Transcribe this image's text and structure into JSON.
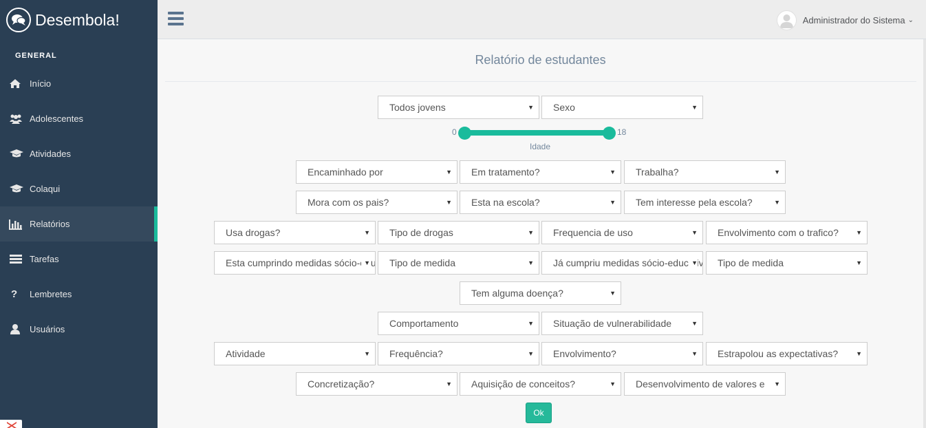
{
  "brand": {
    "title": "Desembola!"
  },
  "sidebar": {
    "section_label": "GENERAL",
    "items": [
      {
        "label": "Início",
        "icon": "home-icon"
      },
      {
        "label": "Adolescentes",
        "icon": "users-icon"
      },
      {
        "label": "Atividades",
        "icon": "graduation-cap-icon"
      },
      {
        "label": "Colaqui",
        "icon": "graduation-cap-icon"
      },
      {
        "label": "Relatórios",
        "icon": "bar-chart-icon",
        "active": true
      },
      {
        "label": "Tarefas",
        "icon": "list-icon"
      },
      {
        "label": "Lembretes",
        "icon": "question-icon"
      },
      {
        "label": "Usuários",
        "icon": "user-icon"
      }
    ]
  },
  "topnav": {
    "user_name": "Administrador do Sistema"
  },
  "page": {
    "title": "Relatório de estudantes"
  },
  "filters": {
    "todos_jovens": "Todos jovens",
    "sexo": "Sexo",
    "encaminhado_por": "Encaminhado por",
    "em_tratamento": "Em tratamento?",
    "trabalha": "Trabalha?",
    "mora_com_pais": "Mora com os pais?",
    "esta_na_escola": "Esta na escola?",
    "interesse_escola": "Tem interesse pela escola?",
    "usa_drogas": "Usa drogas?",
    "tipo_drogas": "Tipo de drogas",
    "frequencia_uso": "Frequencia de uso",
    "envolvimento_trafico": "Envolvimento com o trafico?",
    "cumprindo_medidas": "Esta cumprindo medidas sócio-educativas?",
    "tipo_medida_1": "Tipo de medida",
    "ja_cumpriu_medidas": "Já cumpriu medidas sócio-educativas?",
    "tipo_medida_2": "Tipo de medida",
    "doenca": "Tem alguma doença?",
    "comportamento": "Comportamento",
    "vulnerabilidade": "Situação de vulnerabilidade",
    "atividade": "Atividade",
    "frequencia": "Frequência?",
    "envolvimento": "Envolvimento?",
    "expectativas": "Estrapolou as expectativas?",
    "concretizacao": "Concretização?",
    "aquisicao_conceitos": "Aquisição de conceitos?",
    "desenvolvimento_valores": "Desenvolvimento de valores e"
  },
  "age_slider": {
    "min": "0",
    "max": "18",
    "label": "Idade"
  },
  "submit": {
    "label": "Ok"
  },
  "colors": {
    "sidebar": "#2A3F54",
    "accent": "#1ABB9C",
    "button": "#26B99A"
  }
}
